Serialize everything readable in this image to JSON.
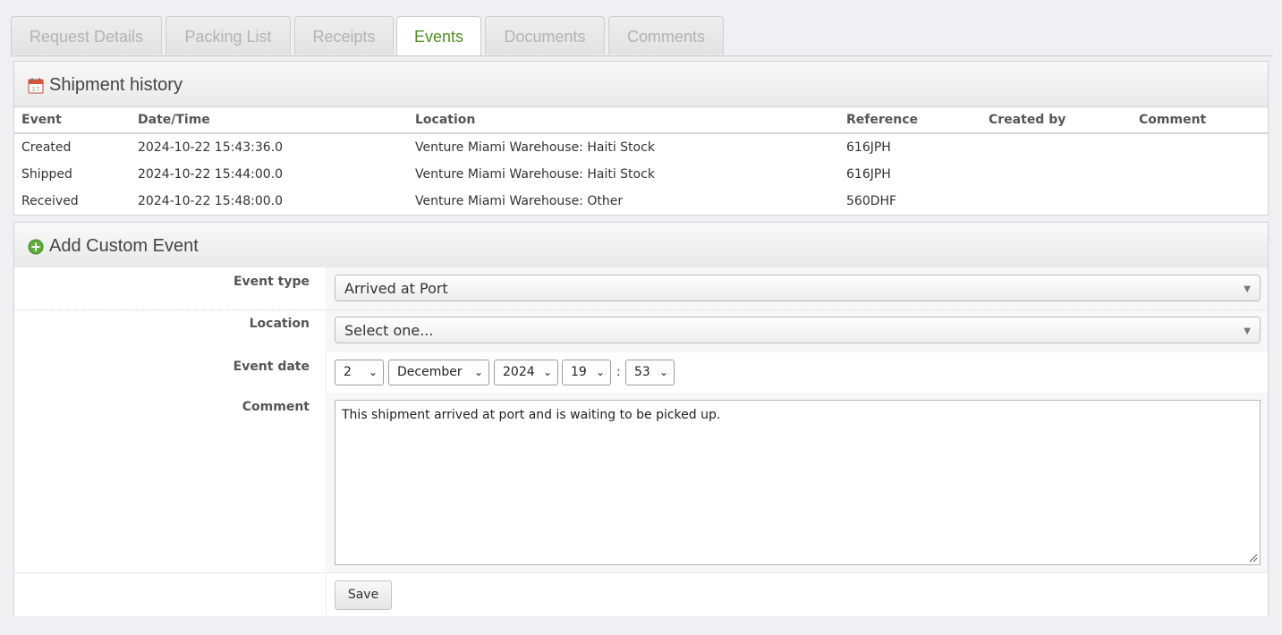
{
  "tabs": [
    {
      "label": "Request Details"
    },
    {
      "label": "Packing List"
    },
    {
      "label": "Receipts"
    },
    {
      "label": "Events"
    },
    {
      "label": "Documents"
    },
    {
      "label": "Comments"
    }
  ],
  "history": {
    "title": "Shipment history",
    "icon": "calendar-icon",
    "columns": [
      "Event",
      "Date/Time",
      "Location",
      "Reference",
      "Created by",
      "Comment"
    ],
    "rows": [
      {
        "event": "Created",
        "datetime": "2024-10-22 15:43:36.0",
        "location": "Venture Miami Warehouse: Haiti Stock",
        "reference": "616JPH",
        "created_by": "",
        "comment": ""
      },
      {
        "event": "Shipped",
        "datetime": "2024-10-22 15:44:00.0",
        "location": "Venture Miami Warehouse: Haiti Stock",
        "reference": "616JPH",
        "created_by": "",
        "comment": ""
      },
      {
        "event": "Received",
        "datetime": "2024-10-22 15:48:00.0",
        "location": "Venture Miami Warehouse: Other",
        "reference": "560DHF",
        "created_by": "",
        "comment": ""
      }
    ]
  },
  "custom_event": {
    "title": "Add Custom Event",
    "icon": "plus-circle-icon",
    "event_type_label": "Event type",
    "event_type_value": "Arrived at Port",
    "location_label": "Location",
    "location_value": "Select one...",
    "date_label": "Event date",
    "date": {
      "day": "2",
      "month": "December",
      "year": "2024",
      "hour": "19",
      "minute": "53",
      "separator": ":"
    },
    "comment_label": "Comment",
    "comment_value": "This shipment arrived at port and is waiting to be picked up.",
    "save_label": "Save"
  },
  "colors": {
    "active_tab": "#4e8f1f",
    "inactive_tab": "#b3b3b3",
    "page_bg": "#f0f0f2"
  }
}
